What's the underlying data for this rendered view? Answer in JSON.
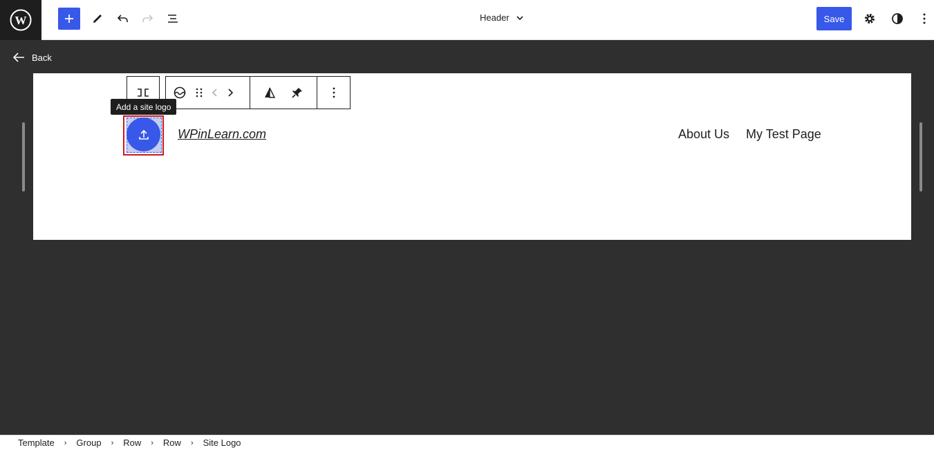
{
  "topbar": {
    "template_title": "Header",
    "save_label": "Save",
    "icons": [
      "wordpress-icon",
      "plus-icon",
      "pen-icon",
      "undo-icon",
      "redo-icon",
      "list-view-icon",
      "chevron-down-icon",
      "gear-icon",
      "half-circle-icon",
      "more-vertical-icon"
    ]
  },
  "back": {
    "label": "Back"
  },
  "block_toolbar": {
    "tooltip": "Add a site logo"
  },
  "site": {
    "title": "WPinLearn.com",
    "nav_items": [
      "About Us",
      "My Test Page"
    ]
  },
  "breadcrumb": [
    "Template",
    "Group",
    "Row",
    "Row",
    "Site Logo"
  ],
  "colors": {
    "accent": "#3858e9",
    "highlight": "#cc1818",
    "canvas_bg": "#2f2f2f"
  }
}
